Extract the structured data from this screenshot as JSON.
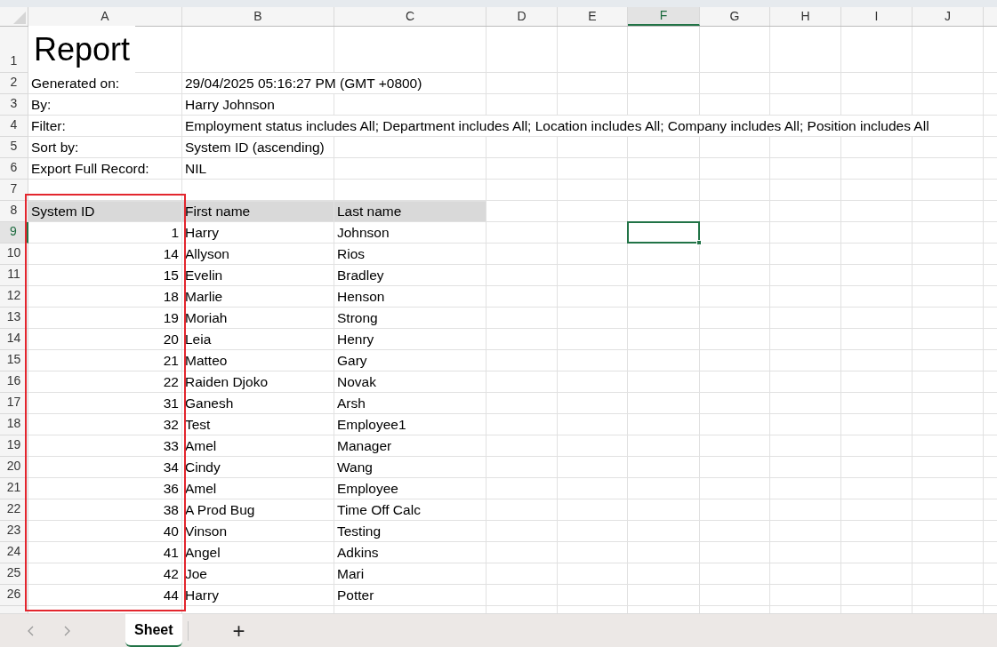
{
  "columns": [
    {
      "label": "A",
      "selected": false
    },
    {
      "label": "B",
      "selected": false
    },
    {
      "label": "C",
      "selected": false
    },
    {
      "label": "D",
      "selected": false
    },
    {
      "label": "E",
      "selected": false
    },
    {
      "label": "F",
      "selected": true
    },
    {
      "label": "G",
      "selected": false
    },
    {
      "label": "H",
      "selected": false
    },
    {
      "label": "I",
      "selected": false
    },
    {
      "label": "J",
      "selected": false
    }
  ],
  "rows": [
    {
      "number": "1",
      "kind": "title",
      "selected": false,
      "cells": {
        "A": "Report"
      }
    },
    {
      "number": "2",
      "kind": "meta",
      "selected": false,
      "cells": {
        "A": "Generated on:",
        "B": "29/04/2025 05:16:27 PM (GMT +0800)"
      }
    },
    {
      "number": "3",
      "kind": "meta",
      "selected": false,
      "cells": {
        "A": "By:",
        "B": "Harry Johnson"
      }
    },
    {
      "number": "4",
      "kind": "meta",
      "selected": false,
      "cells": {
        "A": "Filter:",
        "B": "Employment status includes All; Department includes All; Location includes All; Company includes All; Position includes All"
      }
    },
    {
      "number": "5",
      "kind": "meta",
      "selected": false,
      "cells": {
        "A": "Sort by:",
        "B": "System ID (ascending)"
      }
    },
    {
      "number": "6",
      "kind": "meta",
      "selected": false,
      "cells": {
        "A": "Export Full Record:",
        "B": "NIL"
      }
    },
    {
      "number": "7",
      "kind": "blank",
      "selected": false,
      "cells": {}
    },
    {
      "number": "8",
      "kind": "header",
      "selected": false,
      "cells": {
        "A": "System ID",
        "B": "First name",
        "C": "Last name"
      }
    },
    {
      "number": "9",
      "kind": "data",
      "selected": true,
      "cells": {
        "A": "1",
        "B": "Harry",
        "C": "Johnson"
      }
    },
    {
      "number": "10",
      "kind": "data",
      "selected": false,
      "cells": {
        "A": "14",
        "B": "Allyson",
        "C": "Rios"
      }
    },
    {
      "number": "11",
      "kind": "data",
      "selected": false,
      "cells": {
        "A": "15",
        "B": "Evelin",
        "C": "Bradley"
      }
    },
    {
      "number": "12",
      "kind": "data",
      "selected": false,
      "cells": {
        "A": "18",
        "B": "Marlie",
        "C": "Henson"
      }
    },
    {
      "number": "13",
      "kind": "data",
      "selected": false,
      "cells": {
        "A": "19",
        "B": "Moriah",
        "C": "Strong"
      }
    },
    {
      "number": "14",
      "kind": "data",
      "selected": false,
      "cells": {
        "A": "20",
        "B": "Leia",
        "C": "Henry"
      }
    },
    {
      "number": "15",
      "kind": "data",
      "selected": false,
      "cells": {
        "A": "21",
        "B": "Matteo",
        "C": "Gary"
      }
    },
    {
      "number": "16",
      "kind": "data",
      "selected": false,
      "cells": {
        "A": "22",
        "B": "Raiden Djoko",
        "C": "Novak"
      }
    },
    {
      "number": "17",
      "kind": "data",
      "selected": false,
      "cells": {
        "A": "31",
        "B": "Ganesh",
        "C": "Arsh"
      }
    },
    {
      "number": "18",
      "kind": "data",
      "selected": false,
      "cells": {
        "A": "32",
        "B": "Test",
        "C": "Employee1"
      }
    },
    {
      "number": "19",
      "kind": "data",
      "selected": false,
      "cells": {
        "A": "33",
        "B": "Amel",
        "C": "Manager"
      }
    },
    {
      "number": "20",
      "kind": "data",
      "selected": false,
      "cells": {
        "A": "34",
        "B": "Cindy",
        "C": "Wang"
      }
    },
    {
      "number": "21",
      "kind": "data",
      "selected": false,
      "cells": {
        "A": "36",
        "B": "Amel",
        "C": "Employee"
      }
    },
    {
      "number": "22",
      "kind": "data",
      "selected": false,
      "cells": {
        "A": "38",
        "B": "A Prod Bug",
        "C": "Time Off Calc"
      }
    },
    {
      "number": "23",
      "kind": "data",
      "selected": false,
      "cells": {
        "A": "40",
        "B": "Vinson",
        "C": "Testing"
      }
    },
    {
      "number": "24",
      "kind": "data",
      "selected": false,
      "cells": {
        "A": "41",
        "B": "Angel",
        "C": "Adkins"
      }
    },
    {
      "number": "25",
      "kind": "data",
      "selected": false,
      "cells": {
        "A": "42",
        "B": "Joe",
        "C": "Mari"
      }
    },
    {
      "number": "26",
      "kind": "data",
      "selected": false,
      "cells": {
        "A": "44",
        "B": "Harry",
        "C": "Potter"
      }
    }
  ],
  "sheet_tabs": [
    {
      "label": "Sheet",
      "selected": true
    }
  ],
  "add_sheet": "+"
}
